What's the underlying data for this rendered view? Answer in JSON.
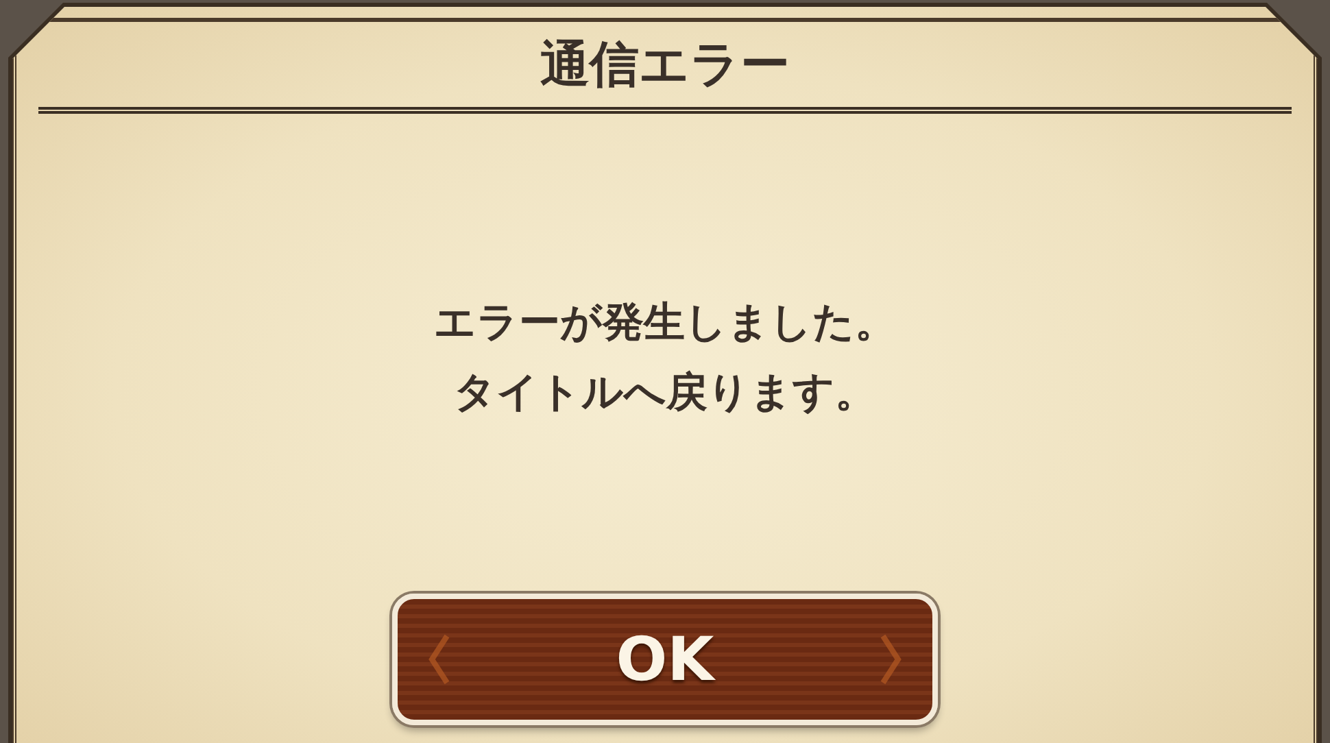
{
  "dialog": {
    "title": "通信エラー",
    "message": [
      "エラーが発生しました。",
      "タイトルへ戻ります。"
    ],
    "buttons": [
      {
        "label": "OK"
      }
    ]
  }
}
